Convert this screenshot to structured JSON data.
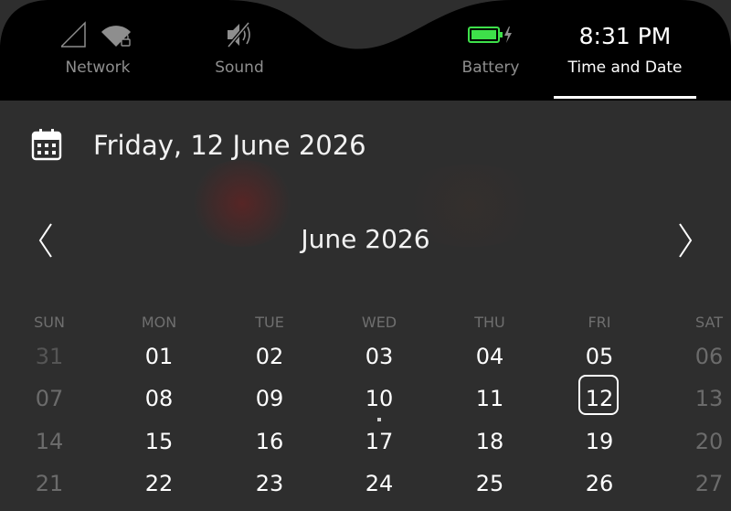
{
  "indicators": {
    "network": {
      "label": "Network",
      "icon": "signal-wifi-icon"
    },
    "sound": {
      "label": "Sound",
      "icon": "speaker-muted-icon"
    },
    "battery": {
      "label": "Battery",
      "icon": "battery-charging-icon",
      "level_percent": 90,
      "color": "#3ee04a"
    },
    "time": {
      "clock": "8:31 PM",
      "label": "Time and Date",
      "selected": true
    }
  },
  "date_header": {
    "icon": "calendar-icon",
    "full_date": "Friday, 12 June 2026"
  },
  "calendar": {
    "month_title": "June 2026",
    "prev_icon": "chevron-left-icon",
    "next_icon": "chevron-right-icon",
    "weekdays": [
      "SUN",
      "MON",
      "TUE",
      "WED",
      "THU",
      "FRI",
      "SAT"
    ],
    "weeks": [
      [
        "31",
        "01",
        "02",
        "03",
        "04",
        "05",
        "06"
      ],
      [
        "07",
        "08",
        "09",
        "10",
        "11",
        "12",
        "13"
      ],
      [
        "14",
        "15",
        "16",
        "17",
        "18",
        "19",
        "20"
      ],
      [
        "21",
        "22",
        "23",
        "24",
        "25",
        "26",
        "27"
      ]
    ],
    "selected_day": "12",
    "today_marker_day": "10"
  }
}
